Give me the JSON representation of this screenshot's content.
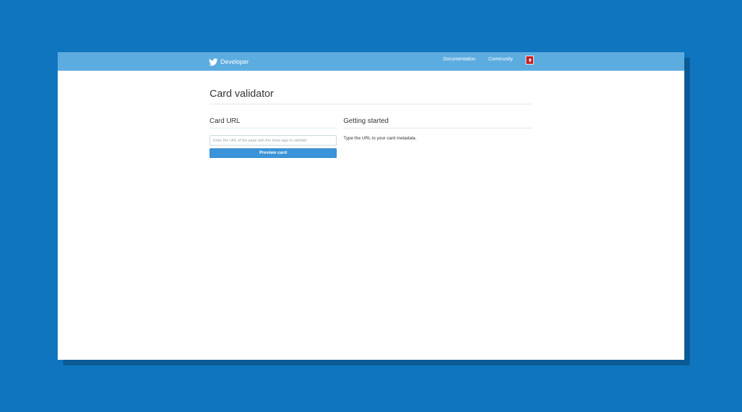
{
  "colors": {
    "background": "#1075bf",
    "topbar": "#5dacdf",
    "button": "#3b94d9",
    "avatar": "#c62025"
  },
  "header": {
    "logo_icon": "twitter-bird-icon",
    "brand": "Developer",
    "nav": {
      "documentation": "Documentation",
      "community": "Community"
    },
    "avatar_icon": "user-avatar-icon"
  },
  "main": {
    "title": "Card validator",
    "card_url": {
      "heading": "Card URL",
      "input_placeholder": "Enter the URL of the page with the meta tags to validate",
      "input_value": "",
      "button_label": "Preview card"
    },
    "getting_started": {
      "heading": "Getting started",
      "text": "Type the URL to your card metadata."
    }
  }
}
